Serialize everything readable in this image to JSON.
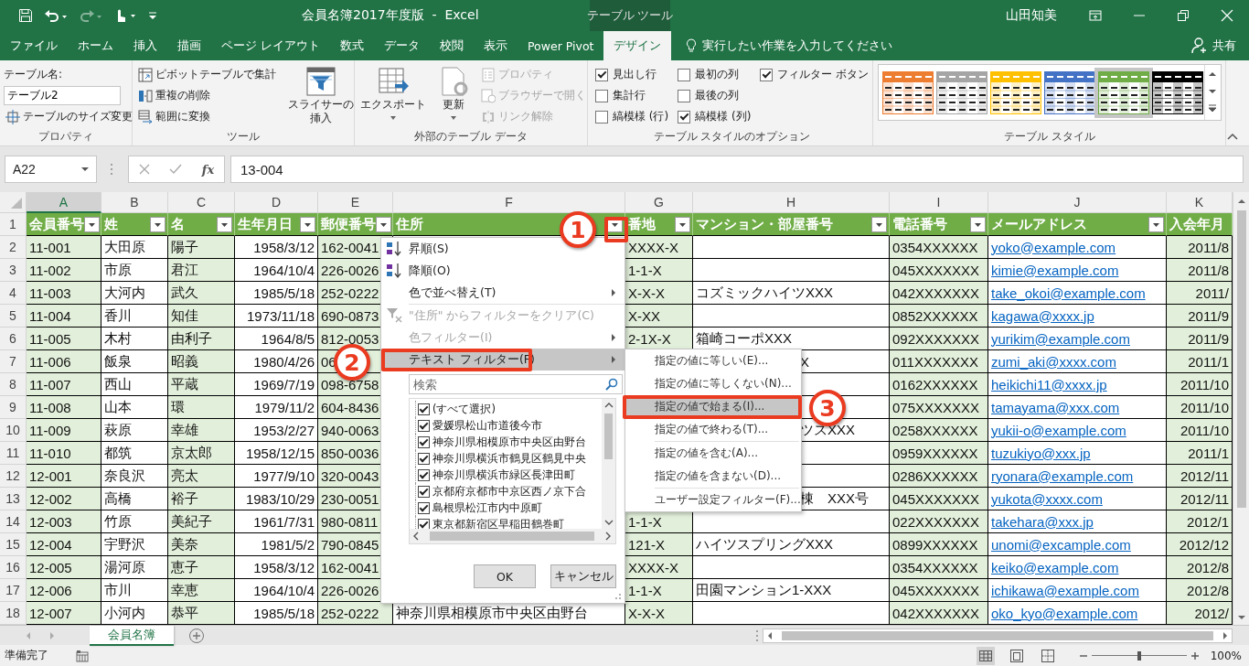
{
  "title_bar": {
    "quick_access": [
      {
        "disabled": false
      },
      {
        "disabled": false
      },
      {
        "disabled": true
      },
      {
        "disabled": false
      },
      {
        "disabled": false
      }
    ],
    "title": "会員名簿2017年度版  -  Excel",
    "context_tab": "テーブル ツール",
    "user": "山田知美"
  },
  "tabs": [
    {
      "label": "ファイル",
      "selected": false
    },
    {
      "label": "ホーム",
      "selected": false
    },
    {
      "label": "挿入",
      "selected": false
    },
    {
      "label": "描画",
      "selected": false
    },
    {
      "label": "ページ レイアウト",
      "selected": false
    },
    {
      "label": "数式",
      "selected": false
    },
    {
      "label": "データ",
      "selected": false
    },
    {
      "label": "校閲",
      "selected": false
    },
    {
      "label": "表示",
      "selected": false
    },
    {
      "label": "Power Pivot",
      "selected": false
    },
    {
      "label": "デザイン",
      "selected": true
    }
  ],
  "tell_me": "実行したい作業を入力してください",
  "share": "共有",
  "ribbon": {
    "groups": [
      {
        "label": "プロパティ",
        "controls": [
          {
            "kind": "label",
            "text": "テーブル名:"
          },
          {
            "kind": "input",
            "value": "テーブル2"
          },
          {
            "kind": "small-button",
            "text": "テーブルのサイズ変更",
            "disabled": false
          }
        ]
      },
      {
        "label": "ツール",
        "controls": [
          {
            "kind": "small-button",
            "text": "ピボットテーブルで集計",
            "disabled": false
          },
          {
            "kind": "small-button",
            "text": "重複の削除",
            "disabled": false
          },
          {
            "kind": "small-button",
            "text": "範囲に変換",
            "disabled": false
          },
          {
            "kind": "large-button",
            "text": "スライサーの挿入",
            "disabled": false,
            "menu": false
          }
        ]
      },
      {
        "label": "外部のテーブル データ",
        "controls": [
          {
            "kind": "large-button",
            "text": "エクスポート",
            "disabled": false,
            "menu": true
          },
          {
            "kind": "large-button",
            "text": "更新",
            "disabled": false,
            "menu": true
          },
          {
            "kind": "small-button",
            "text": "プロパティ",
            "disabled": true
          },
          {
            "kind": "small-button",
            "text": "ブラウザーで開く",
            "disabled": true
          },
          {
            "kind": "small-button",
            "text": "リンク解除",
            "disabled": true
          }
        ]
      },
      {
        "label": "テーブル スタイルのオプション",
        "controls": [
          {
            "kind": "checkbox",
            "text": "見出し行",
            "checked": true
          },
          {
            "kind": "checkbox",
            "text": "集計行",
            "checked": false
          },
          {
            "kind": "checkbox",
            "text": "縞模様 (行)",
            "checked": false
          },
          {
            "kind": "checkbox",
            "text": "最初の列",
            "checked": false
          },
          {
            "kind": "checkbox",
            "text": "最後の列",
            "checked": false
          },
          {
            "kind": "checkbox",
            "text": "縞模様 (列)",
            "checked": true
          },
          {
            "kind": "checkbox",
            "text": "フィルター ボタン",
            "checked": true
          }
        ]
      },
      {
        "label": "テーブル スタイル",
        "controls": [
          {
            "kind": "gallery",
            "styles": [
              {
                "color": "#ed7d31",
                "selected": false
              },
              {
                "color": "#a5a5a5",
                "selected": false
              },
              {
                "color": "#ffc000",
                "selected": false
              },
              {
                "color": "#4472c4",
                "selected": false
              },
              {
                "color": "#70ad47",
                "selected": true
              },
              {
                "color": "#000000",
                "selected": false
              }
            ]
          }
        ]
      }
    ]
  },
  "formula_bar": {
    "name_box": "A22",
    "function_label": "fx",
    "formula": "13-004"
  },
  "sheet": {
    "header_row_number": "1",
    "columns": [
      {
        "letter": "A",
        "selected": true,
        "header": "会員番号",
        "right_aligned": false,
        "link": false,
        "filter_button": true
      },
      {
        "letter": "B",
        "selected": false,
        "header": "姓",
        "right_aligned": false,
        "link": false,
        "filter_button": true
      },
      {
        "letter": "C",
        "selected": false,
        "header": "名",
        "right_aligned": false,
        "link": false,
        "filter_button": true
      },
      {
        "letter": "D",
        "selected": false,
        "header": "生年月日",
        "right_aligned": true,
        "link": false,
        "filter_button": true
      },
      {
        "letter": "E",
        "selected": false,
        "header": "郵便番号",
        "right_aligned": false,
        "link": false,
        "filter_button": true
      },
      {
        "letter": "F",
        "selected": false,
        "header": "住所",
        "right_aligned": false,
        "link": false,
        "filter_button": true
      },
      {
        "letter": "G",
        "selected": false,
        "header": "番地",
        "right_aligned": false,
        "link": false,
        "filter_button": true
      },
      {
        "letter": "H",
        "selected": false,
        "header": "マンション・部屋番号",
        "right_aligned": false,
        "link": false,
        "filter_button": true
      },
      {
        "letter": "I",
        "selected": false,
        "header": "電話番号",
        "right_aligned": false,
        "link": false,
        "filter_button": true
      },
      {
        "letter": "J",
        "selected": false,
        "header": "メールアドレス",
        "right_aligned": false,
        "link": true,
        "filter_button": true
      },
      {
        "letter": "K",
        "selected": false,
        "header": "入会年月",
        "right_aligned": true,
        "link": false,
        "filter_button": false
      }
    ],
    "rows": [
      {
        "number": "2",
        "cells": [
          "11-001",
          "大田原",
          "陽子",
          "1958/3/12",
          "162-0041",
          null,
          "XXXX-X",
          null,
          "0354XXXXXX",
          "yoko@example.com",
          "2011/8"
        ]
      },
      {
        "number": "3",
        "cells": [
          "11-002",
          "市原",
          "君江",
          "1964/10/4",
          "226-0026",
          null,
          "1-1-X",
          null,
          "045XXXXXXX",
          "kimie@example.com",
          "2011/8"
        ]
      },
      {
        "number": "4",
        "cells": [
          "11-003",
          "大河内",
          "武久",
          "1985/5/18",
          "252-0222",
          null,
          "X-X-X",
          "コズミックハイツXXX",
          "042XXXXXXX",
          "take_okoi@example.com",
          "2011/"
        ]
      },
      {
        "number": "5",
        "cells": [
          "11-004",
          "香川",
          "知佳",
          "1973/11/18",
          "690-0873",
          null,
          "X-XX",
          null,
          "0852XXXXXX",
          "kagawa@xxxx.jp",
          "2011/9"
        ]
      },
      {
        "number": "6",
        "cells": [
          "11-005",
          "木村",
          "由利子",
          "1964/8/5",
          "812-0053",
          null,
          "2-1X-X",
          "箱崎コーポXXX",
          "092XXXXXXX",
          "yurikim@example.com",
          "2011/9"
        ]
      },
      {
        "number": "7",
        "cells": [
          "11-006",
          "飯泉",
          "昭義",
          "1980/4/26",
          "06",
          null,
          null,
          {
            "text": "X",
            "partial": true
          },
          "011XXXXXXX",
          "zumi_aki@xxxx.com",
          "2011/1"
        ]
      },
      {
        "number": "8",
        "cells": [
          "11-007",
          "西山",
          "平蔵",
          "1969/7/19",
          "098-6758",
          null,
          null,
          null,
          "0162XXXXXX",
          "heikichi11@xxxx.jp",
          "2011/10"
        ]
      },
      {
        "number": "9",
        "cells": [
          "11-008",
          "山本",
          "環",
          "1979/11/2",
          "604-8436",
          null,
          null,
          null,
          "075XXXXXXX",
          "tamayama@xxx.com",
          "2011/10"
        ]
      },
      {
        "number": "10",
        "cells": [
          "11-009",
          "萩原",
          "幸雄",
          "1953/2/27",
          "940-0063",
          null,
          null,
          {
            "text": "ツスXXX",
            "partial": true
          },
          "0258XXXXXX",
          "yukii-o@example.com",
          "2011/10"
        ]
      },
      {
        "number": "11",
        "cells": [
          "11-010",
          "都筑",
          "京太郎",
          "1958/12/15",
          "850-0036",
          null,
          null,
          null,
          "0959XXXXXX",
          "tuzukiyo@xxx.jp",
          "2011/1"
        ]
      },
      {
        "number": "12",
        "cells": [
          "12-001",
          "奈良沢",
          "亮太",
          "1977/9/10",
          "320-0043",
          null,
          null,
          null,
          "0286XXXXXX",
          "ryonara@example.com",
          "2012/11"
        ]
      },
      {
        "number": "13",
        "cells": [
          "12-002",
          "高橋",
          "裕子",
          "1983/10/29",
          "230-0051",
          null,
          null,
          {
            "text": "棟　XXX号",
            "partial": true
          },
          "045XXXXXXX",
          "yukota@xxxx.com",
          "2012/11"
        ]
      },
      {
        "number": "14",
        "cells": [
          "12-003",
          "竹原",
          "美紀子",
          "1961/7/31",
          "980-0811",
          null,
          "1-1-X",
          null,
          "022XXXXXXX",
          "takehara@xxx.jp",
          "2012/1"
        ]
      },
      {
        "number": "15",
        "cells": [
          "12-004",
          "宇野沢",
          "美奈",
          "1981/5/2",
          "790-0845",
          null,
          "121-X",
          "ハイツスプリングXXX",
          "0899XXXXXX",
          "unomi@excample.com",
          "2012/12"
        ]
      },
      {
        "number": "16",
        "cells": [
          "12-005",
          "湯河原",
          "恵子",
          "1958/3/12",
          "162-0041",
          null,
          "XXXX-X",
          null,
          "0354XXXXXX",
          "keiko@example.com",
          "2012/8"
        ]
      },
      {
        "number": "17",
        "cells": [
          "12-006",
          "市川",
          "幸恵",
          "1964/10/4",
          "226-0026",
          null,
          "1-1-X",
          "田園マンション1-XXX",
          "045XXXXXXX",
          "ichikawa@example.com",
          "2012/8"
        ]
      },
      {
        "number": "18",
        "cells": [
          "12-007",
          "小河内",
          "恭平",
          "1985/5/18",
          "252-0222",
          "神奈川県相模原市中央区由野台",
          "X-X-X",
          null,
          "042XXXXXXX",
          "oko_kyo@example.com",
          "2012/"
        ]
      }
    ]
  },
  "filter_menu": {
    "items": [
      {
        "kind": "item",
        "label": "昇順(S)",
        "disabled": false,
        "selected": false,
        "submenu": false
      },
      {
        "kind": "item",
        "label": "降順(O)",
        "disabled": false,
        "selected": false,
        "submenu": false
      },
      {
        "kind": "item",
        "label": "色で並べ替え(T)",
        "disabled": false,
        "selected": false,
        "submenu": true
      },
      {
        "kind": "separator"
      },
      {
        "kind": "item",
        "label": "\"住所\" からフィルターをクリア(C)",
        "disabled": true,
        "selected": false,
        "submenu": false
      },
      {
        "kind": "item",
        "label": "色フィルター(I)",
        "disabled": true,
        "selected": false,
        "submenu": true
      },
      {
        "kind": "item",
        "label": "テキスト フィルター(F)",
        "disabled": false,
        "selected": true,
        "submenu": true
      }
    ],
    "search_placeholder": "検索",
    "values": [
      {
        "label": "(すべて選択)",
        "checked": true
      },
      {
        "label": "愛媛県松山市道後今市",
        "checked": true
      },
      {
        "label": "神奈川県相模原市中央区由野台",
        "checked": true
      },
      {
        "label": "神奈川県横浜市鶴見区鶴見中央",
        "checked": true
      },
      {
        "label": "神奈川県横浜市緑区長津田町",
        "checked": true
      },
      {
        "label": "京都府京都市中京区西ノ京下合",
        "checked": true
      },
      {
        "label": "島根県松江市内中原町",
        "checked": true
      },
      {
        "label": "東京都新宿区早稲田鶴巻町",
        "checked": true
      }
    ],
    "buttons": [
      "OK",
      "キャンセル"
    ]
  },
  "text_filter_submenu": {
    "items": [
      {
        "kind": "item",
        "label": "指定の値に等しい(E)...",
        "selected": false
      },
      {
        "kind": "item",
        "label": "指定の値に等しくない(N)...",
        "selected": false
      },
      {
        "kind": "item",
        "label": "指定の値で始まる(I)...",
        "selected": true
      },
      {
        "kind": "item",
        "label": "指定の値で終わる(T)...",
        "selected": false
      },
      {
        "kind": "separator"
      },
      {
        "kind": "item",
        "label": "指定の値を含む(A)...",
        "selected": false
      },
      {
        "kind": "item",
        "label": "指定の値を含まない(D)...",
        "selected": false
      },
      {
        "kind": "separator"
      },
      {
        "kind": "item",
        "label": "ユーザー設定フィルター(F)...",
        "selected": false
      }
    ]
  },
  "annotations": [
    {
      "number": "1"
    },
    {
      "number": "2"
    },
    {
      "number": "3"
    }
  ],
  "sheet_tabs": [
    {
      "label": "会員名簿",
      "selected": true
    }
  ],
  "status_bar": {
    "text": "準備完了",
    "views": [
      {
        "selected": true
      },
      {
        "selected": false
      },
      {
        "selected": false
      }
    ],
    "zoom": {
      "level": 0.5,
      "reading": "100%"
    }
  }
}
